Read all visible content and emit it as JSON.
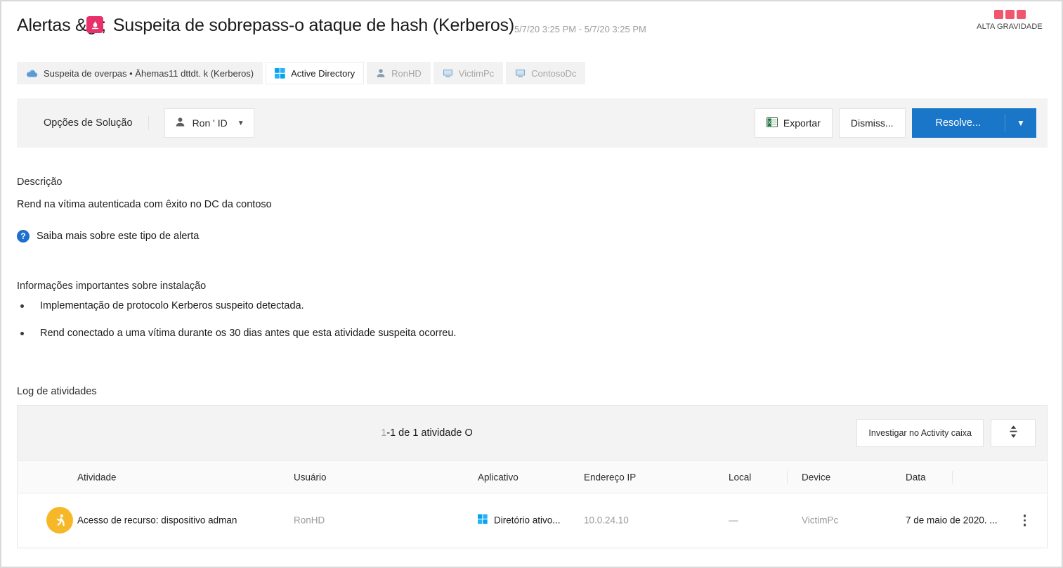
{
  "header": {
    "title_prefix": "Alertas &gt;",
    "title_main": "Suspeita de sobrepass-o ataque de hash (Kerberos)",
    "date_range": "5/7/20 3:25 PM - 5/7/20 3:25 PM",
    "severity_label": "ALTA GRAVIDADE",
    "severity_color": "#f1566f",
    "severity_icon": "fire-alert-icon"
  },
  "tabs": [
    {
      "label": "Suspeita de overpas • Ähemas11 dttdt. k (Kerberos)",
      "icon": "cloud-icon",
      "state": "normal"
    },
    {
      "label": "Active Directory",
      "icon": "windows-icon",
      "state": "active"
    },
    {
      "label": "RonHD",
      "icon": "user-icon",
      "state": "dim"
    },
    {
      "label": "VictimPc",
      "icon": "monitor-icon",
      "state": "dim"
    },
    {
      "label": "ContosoDc",
      "icon": "monitor-icon",
      "state": "dim"
    }
  ],
  "toolbar": {
    "resolution_label": "Opções de Solução",
    "user_select_value": "Ron ' ID",
    "export_label": "Exportar",
    "dismiss_label": "Dismiss...",
    "resolve_label": "Resolve...",
    "primary_color": "#1a76c8"
  },
  "description": {
    "label": "Descrição",
    "text": "Rend na vítima autenticada com êxito no DC da contoso",
    "learn_more": "Saiba mais sobre este tipo de alerta"
  },
  "important": {
    "label": "Informações importantes sobre instalação",
    "bullets": [
      "Implementação de protocolo Kerberos suspeito detectada.",
      "Rend conectado a uma vítima durante os 30 dias antes que esta atividade suspeita ocorreu."
    ]
  },
  "activity_log": {
    "label": "Log de atividades",
    "count_lead": "1",
    "count_text": "-1 de 1 atividade O",
    "investigate_label": "Investigar no Activity caixa",
    "sort_icon": "sort-updown-icon",
    "columns": [
      "Atividade",
      "Usuário",
      "Aplicativo",
      "Endereço IP",
      "Local",
      "Device",
      "Data"
    ],
    "rows": [
      {
        "icon": "running-person-icon",
        "atividade": "Acesso de recurso: dispositivo adman",
        "usuario": "RonHD",
        "aplicativo": "Diretório ativo...",
        "aplicativo_icon": "windows-icon",
        "endereco_ip": "10.0.24.10",
        "local": "—",
        "device": "VictimPc",
        "data": "7 de maio de 2020. ...",
        "menu_icon": "kebab-menu-icon"
      }
    ]
  }
}
